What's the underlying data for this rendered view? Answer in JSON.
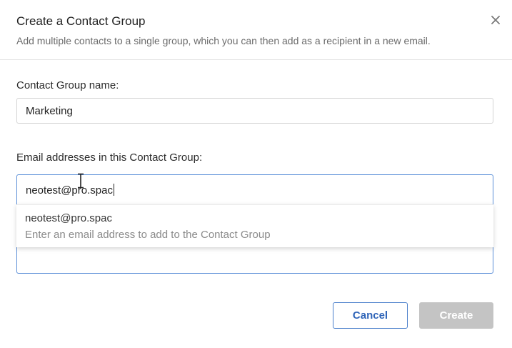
{
  "dialog": {
    "title": "Create a Contact Group",
    "subtitle": "Add multiple contacts to a single group, which you can then add as a recipient in a new email.",
    "close_icon": "close-icon"
  },
  "group_name": {
    "label": "Contact Group name:",
    "value": "Marketing"
  },
  "emails": {
    "label": "Email addresses in this Contact Group:",
    "value": "neotest@pro.spac"
  },
  "suggestion": {
    "email": "neotest@pro.spac",
    "hint": "Enter an email address to add to the Contact Group"
  },
  "buttons": {
    "cancel": "Cancel",
    "create": "Create"
  },
  "colors": {
    "accent": "#2f64b8",
    "focus_border": "#5b8fd8",
    "disabled_button": "#c4c4c4"
  }
}
